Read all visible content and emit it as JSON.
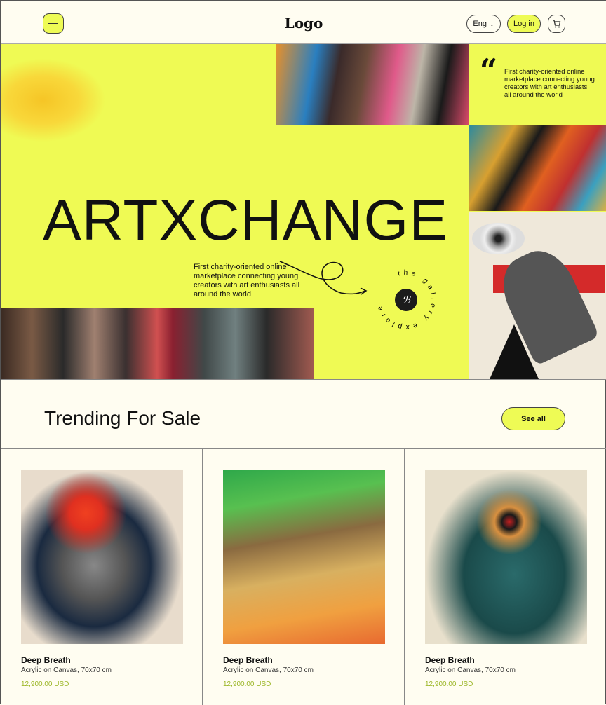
{
  "header": {
    "logo": "Logo",
    "language": "Eng",
    "login": "Log in"
  },
  "hero": {
    "title": "ARTXCHANGE",
    "description": "First charity-oriented online marketplace connecting young creators with art enthusiasts all around the world",
    "quote": "First charity-oriented online marketplace connecting young creators with art enthusiasts all around the world",
    "badge_text": "the gallery explore"
  },
  "trending": {
    "title": "Trending For Sale",
    "see_all": "See all",
    "items": [
      {
        "name": "Deep Breath",
        "medium": "Acrylic on Canvas, 70x70 cm",
        "price": "12,900.00 USD"
      },
      {
        "name": "Deep Breath",
        "medium": "Acrylic on Canvas, 70x70 cm",
        "price": "12,900.00 USD"
      },
      {
        "name": "Deep Breath",
        "medium": "Acrylic on Canvas, 70x70 cm",
        "price": "12,900.00 USD"
      }
    ]
  },
  "colors": {
    "accent": "#effa54",
    "price": "#9ab523"
  }
}
